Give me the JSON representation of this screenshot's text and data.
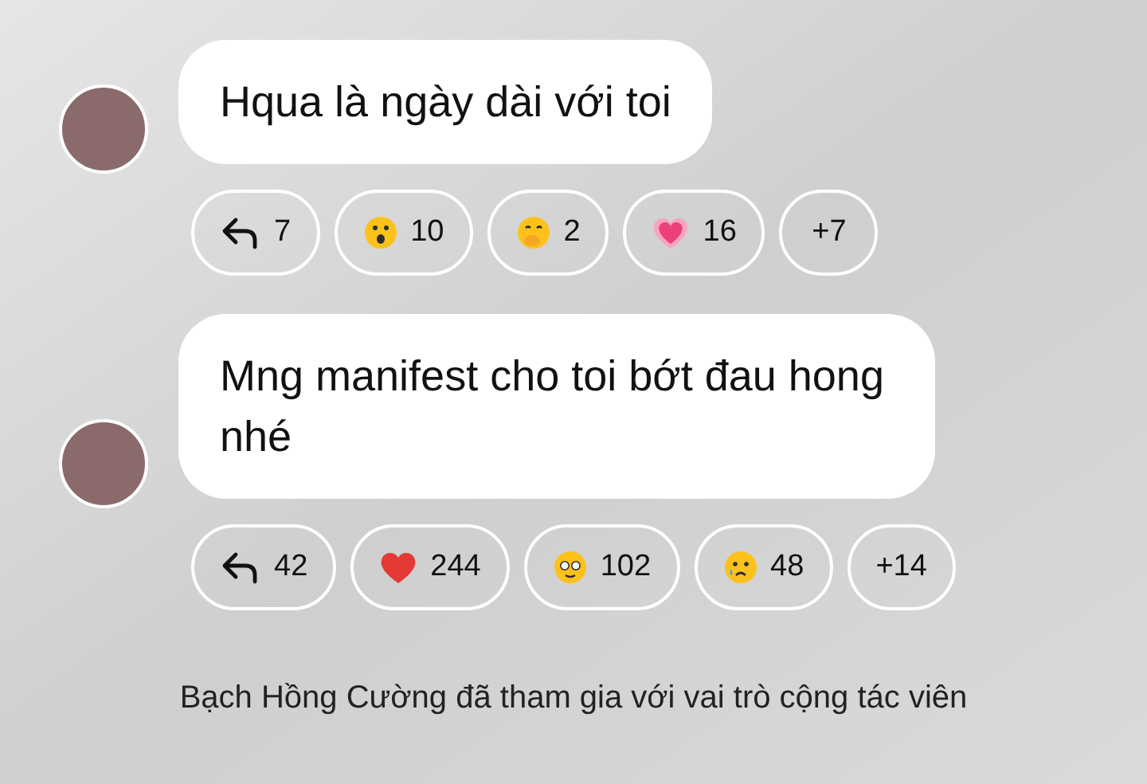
{
  "messages": [
    {
      "text": "Hqua là ngày dài với toi",
      "reactions": [
        {
          "kind": "reply",
          "count": "7"
        },
        {
          "kind": "astonished",
          "count": "10"
        },
        {
          "kind": "hand-over-mouth",
          "count": "2"
        },
        {
          "kind": "growing-heart",
          "count": "16"
        },
        {
          "kind": "more",
          "count": "+7"
        }
      ]
    },
    {
      "text": "Mng manifest cho toi bớt đau hong nhé",
      "reactions": [
        {
          "kind": "reply",
          "count": "42"
        },
        {
          "kind": "red-heart",
          "count": "244"
        },
        {
          "kind": "pleading",
          "count": "102"
        },
        {
          "kind": "crying",
          "count": "48"
        },
        {
          "kind": "more",
          "count": "+14"
        }
      ]
    }
  ],
  "notice": "Bạch Hồng Cường đã tham gia với vai trò cộng tác viên"
}
